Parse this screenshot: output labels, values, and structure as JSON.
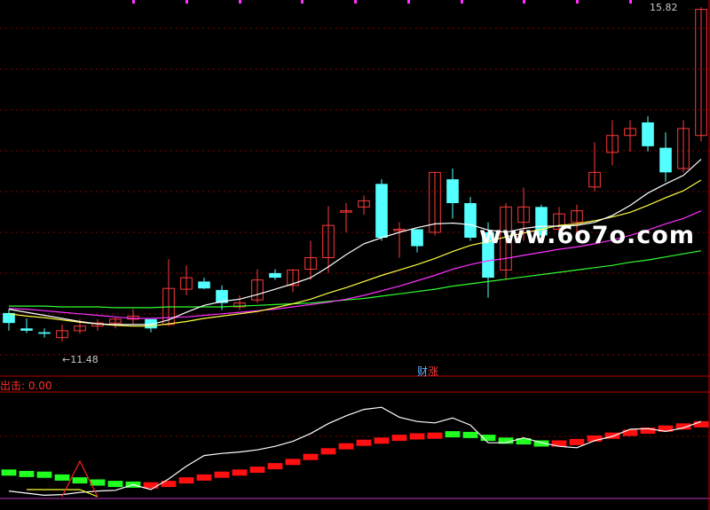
{
  "chart_data": {
    "type": "candlestick",
    "price_max_label": "15.82",
    "price_min_label": "←11.48",
    "panel_tag_part1": "财",
    "panel_tag_part2": "涨",
    "indicator_label": "出击: 0.00",
    "watermark": "www.6o7o.com",
    "price_range": [
      11.35,
      15.85
    ],
    "candles": [
      {
        "o": 11.87,
        "h": 11.92,
        "l": 11.64,
        "c": 11.74
      },
      {
        "o": 11.67,
        "h": 11.8,
        "l": 11.61,
        "c": 11.64
      },
      {
        "o": 11.62,
        "h": 11.67,
        "l": 11.55,
        "c": 11.6
      },
      {
        "o": 11.55,
        "h": 11.72,
        "l": 11.5,
        "c": 11.64
      },
      {
        "o": 11.64,
        "h": 11.79,
        "l": 11.6,
        "c": 11.7
      },
      {
        "o": 11.7,
        "h": 11.79,
        "l": 11.64,
        "c": 11.74
      },
      {
        "o": 11.74,
        "h": 11.81,
        "l": 11.67,
        "c": 11.79
      },
      {
        "o": 11.79,
        "h": 11.92,
        "l": 11.72,
        "c": 11.83
      },
      {
        "o": 11.79,
        "h": 11.79,
        "l": 11.62,
        "c": 11.67
      },
      {
        "o": 11.72,
        "h": 12.57,
        "l": 11.7,
        "c": 12.19
      },
      {
        "o": 12.18,
        "h": 12.49,
        "l": 12.1,
        "c": 12.33
      },
      {
        "o": 12.28,
        "h": 12.33,
        "l": 12.18,
        "c": 12.19
      },
      {
        "o": 12.17,
        "h": 12.23,
        "l": 11.91,
        "c": 12
      },
      {
        "o": 11.95,
        "h": 12.1,
        "l": 11.91,
        "c": 12
      },
      {
        "o": 12.04,
        "h": 12.44,
        "l": 12,
        "c": 12.3
      },
      {
        "o": 12.39,
        "h": 12.44,
        "l": 12.3,
        "c": 12.33
      },
      {
        "o": 12.23,
        "h": 12.44,
        "l": 12.14,
        "c": 12.43
      },
      {
        "o": 12.44,
        "h": 12.81,
        "l": 12.3,
        "c": 12.59
      },
      {
        "o": 12.59,
        "h": 13.26,
        "l": 12.39,
        "c": 13.01
      },
      {
        "o": 13.2,
        "h": 13.3,
        "l": 12.92,
        "c": 13.2
      },
      {
        "o": 13.25,
        "h": 13.4,
        "l": 13.15,
        "c": 13.33
      },
      {
        "o": 13.55,
        "h": 13.61,
        "l": 12.81,
        "c": 12.85
      },
      {
        "o": 12.96,
        "h": 13.05,
        "l": 12.59,
        "c": 12.96
      },
      {
        "o": 12.96,
        "h": 12.96,
        "l": 12.66,
        "c": 12.74
      },
      {
        "o": 12.92,
        "h": 13.7,
        "l": 12.88,
        "c": 13.7
      },
      {
        "o": 13.61,
        "h": 13.75,
        "l": 13.1,
        "c": 13.3
      },
      {
        "o": 13.3,
        "h": 13.38,
        "l": 12.81,
        "c": 12.85
      },
      {
        "o": 12.92,
        "h": 13.05,
        "l": 12.07,
        "c": 12.33
      },
      {
        "o": 12.43,
        "h": 13.3,
        "l": 12.3,
        "c": 13.25
      },
      {
        "o": 13.05,
        "h": 13.5,
        "l": 12.81,
        "c": 13.25
      },
      {
        "o": 13.25,
        "h": 13.28,
        "l": 12.85,
        "c": 12.88
      },
      {
        "o": 12.96,
        "h": 13.25,
        "l": 12.85,
        "c": 13.16
      },
      {
        "o": 13.05,
        "h": 13.28,
        "l": 12.88,
        "c": 13.2
      },
      {
        "o": 13.51,
        "h": 14.09,
        "l": 13.45,
        "c": 13.7
      },
      {
        "o": 13.96,
        "h": 14.38,
        "l": 13.79,
        "c": 14.18
      },
      {
        "o": 14.18,
        "h": 14.38,
        "l": 13.97,
        "c": 14.27
      },
      {
        "o": 14.35,
        "h": 14.43,
        "l": 13.97,
        "c": 14.04
      },
      {
        "o": 14.02,
        "h": 14.22,
        "l": 13.58,
        "c": 13.7
      },
      {
        "o": 13.75,
        "h": 14.38,
        "l": 13.7,
        "c": 14.27
      },
      {
        "o": 14.18,
        "h": 15.85,
        "l": 14.1,
        "c": 15.82
      }
    ],
    "ma_white": [
      11.92,
      11.88,
      11.84,
      11.8,
      11.76,
      11.73,
      11.72,
      11.72,
      11.72,
      11.78,
      11.88,
      11.97,
      12.02,
      12.05,
      12.11,
      12.18,
      12.25,
      12.33,
      12.47,
      12.63,
      12.77,
      12.85,
      12.92,
      12.98,
      13.03,
      13.04,
      13.02,
      12.95,
      12.92,
      12.97,
      13,
      13,
      13.01,
      13.05,
      13.14,
      13.27,
      13.43,
      13.55,
      13.66,
      13.87
    ],
    "ma_yellow": [
      11.86,
      11.83,
      11.81,
      11.78,
      11.75,
      11.73,
      11.71,
      11.7,
      11.7,
      11.73,
      11.76,
      11.8,
      11.83,
      11.86,
      11.89,
      11.94,
      11.99,
      12.05,
      12.13,
      12.2,
      12.28,
      12.36,
      12.43,
      12.5,
      12.58,
      12.67,
      12.75,
      12.8,
      12.86,
      12.91,
      12.96,
      13.01,
      13.03,
      13.07,
      13.12,
      13.18,
      13.27,
      13.37,
      13.46,
      13.6
    ],
    "ma_magenta": [
      11.93,
      11.92,
      11.9,
      11.88,
      11.86,
      11.84,
      11.82,
      11.8,
      11.8,
      11.81,
      11.82,
      11.84,
      11.86,
      11.88,
      11.9,
      11.92,
      11.95,
      11.98,
      12.01,
      12.05,
      12.1,
      12.16,
      12.22,
      12.29,
      12.36,
      12.44,
      12.5,
      12.55,
      12.58,
      12.62,
      12.66,
      12.7,
      12.73,
      12.77,
      12.82,
      12.88,
      12.95,
      13.03,
      13.1,
      13.2
    ],
    "ma_green": [
      11.96,
      11.96,
      11.96,
      11.95,
      11.95,
      11.95,
      11.94,
      11.94,
      11.94,
      11.95,
      11.95,
      11.95,
      11.95,
      11.96,
      11.97,
      11.98,
      11.99,
      12,
      12.02,
      12.04,
      12.06,
      12.09,
      12.12,
      12.15,
      12.18,
      12.22,
      12.25,
      12.28,
      12.31,
      12.34,
      12.37,
      12.4,
      12.43,
      12.46,
      12.49,
      12.53,
      12.56,
      12.6,
      12.64,
      12.68
    ],
    "ind_white": [
      0.18,
      0.15,
      0.12,
      0.13,
      0.16,
      0.18,
      0.19,
      0.27,
      0.2,
      0.35,
      0.53,
      0.68,
      0.71,
      0.73,
      0.76,
      0.81,
      0.88,
      0.99,
      1.13,
      1.24,
      1.33,
      1.36,
      1.22,
      1.16,
      1.14,
      1.21,
      1.11,
      0.86,
      0.86,
      0.93,
      0.86,
      0.81,
      0.79,
      0.89,
      0.95,
      1.05,
      1.06,
      1.02,
      1.07,
      1.16
    ],
    "ind_blocks": [
      0.44,
      0.42,
      0.41,
      0.37,
      0.33,
      0.3,
      0.28,
      0.27,
      0.26,
      0.28,
      0.33,
      0.37,
      0.41,
      0.44,
      0.48,
      0.53,
      0.59,
      0.66,
      0.74,
      0.81,
      0.86,
      0.89,
      0.93,
      0.95,
      0.96,
      0.98,
      0.97,
      0.93,
      0.89,
      0.88,
      0.85,
      0.85,
      0.87,
      0.92,
      0.96,
      1.0,
      1.03,
      1.06,
      1.09,
      1.12
    ],
    "ind_blocks_green": [
      true,
      true,
      true,
      true,
      true,
      true,
      true,
      true,
      false,
      false,
      false,
      false,
      false,
      false,
      false,
      false,
      false,
      false,
      false,
      false,
      false,
      false,
      false,
      false,
      false,
      true,
      true,
      true,
      true,
      true,
      true,
      false,
      false,
      false,
      false,
      false,
      false,
      false,
      false,
      false
    ],
    "ind_yellow": [
      null,
      0.2,
      0.2,
      0.2,
      0.2,
      0.1,
      null,
      null,
      null,
      null,
      null,
      null,
      null,
      null,
      null,
      null,
      null,
      null,
      null,
      null,
      null,
      null,
      null,
      null,
      null,
      null,
      null,
      null,
      null,
      null,
      null,
      null,
      null,
      null,
      null,
      null,
      null,
      null,
      null,
      null
    ],
    "ind_red_spike": [
      null,
      null,
      null,
      0.1,
      0.6,
      0.1,
      null,
      null,
      null,
      null,
      null,
      null,
      null,
      null,
      null,
      null,
      null,
      null,
      null,
      null,
      null,
      null,
      null,
      null,
      null,
      null,
      null,
      null,
      null,
      null,
      null,
      null,
      null,
      null,
      null,
      null,
      null,
      null,
      null,
      null
    ],
    "ind_range": [
      0,
      1.6
    ],
    "colors": {
      "up": "#ff3a3a",
      "down": "#54ffff",
      "ma_white": "#ffffff",
      "ma_yellow": "#ffff40",
      "ma_magenta": "#ff30ff",
      "ma_green": "#30ff30",
      "grid": "#8b0000",
      "border": "#c00000"
    }
  }
}
